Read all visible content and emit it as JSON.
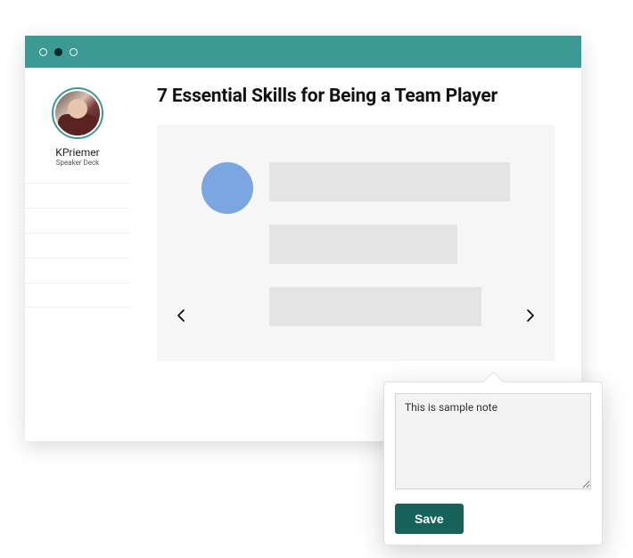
{
  "user": {
    "name": "KPriemer",
    "subtitle": "Speaker Deck"
  },
  "page": {
    "title": "7 Essential Skills for Being a Team Player"
  },
  "note": {
    "value": "This is sample note",
    "save_label": "Save"
  },
  "colors": {
    "accent": "#3b9a94",
    "button": "#17635a",
    "circle": "#7ba7e1"
  }
}
